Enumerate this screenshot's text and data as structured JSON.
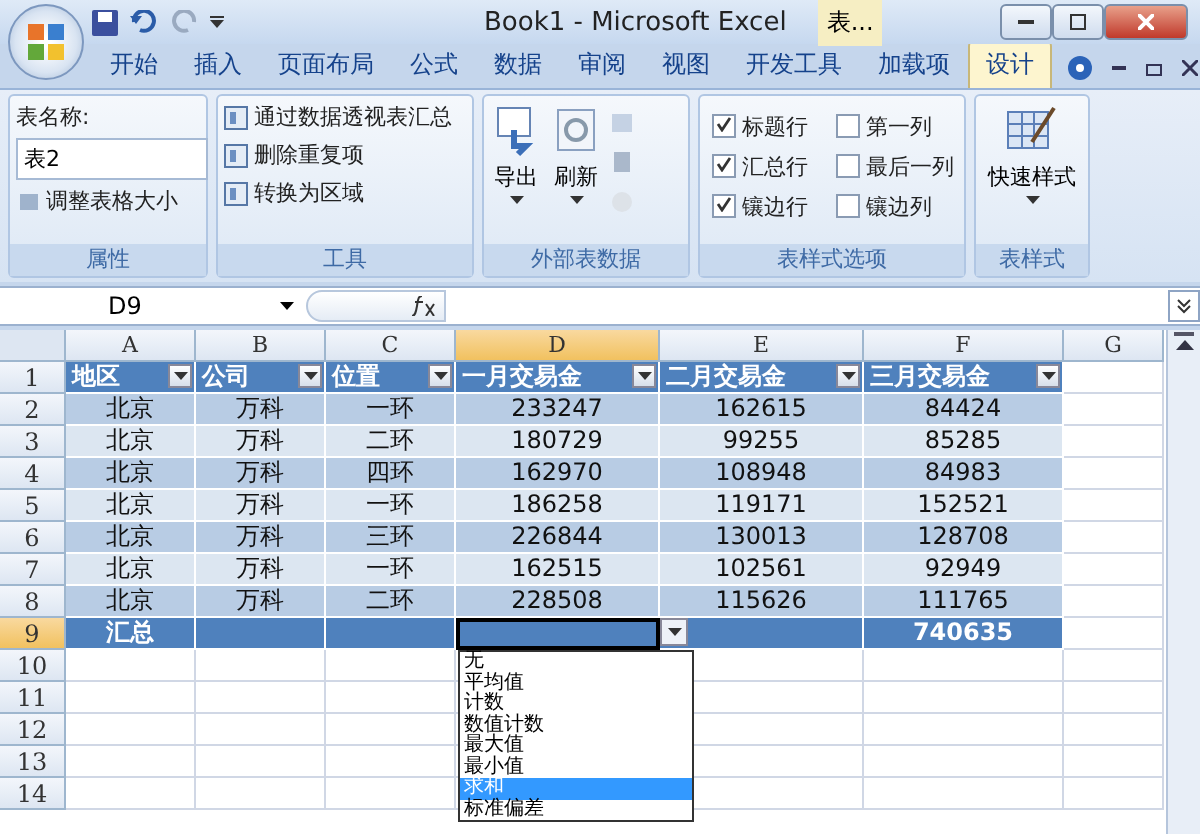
{
  "window": {
    "title": "Book1 - Microsoft Excel",
    "context_tab": "表..."
  },
  "ribbon_tabs": [
    {
      "label": "开始",
      "selected": false
    },
    {
      "label": "插入",
      "selected": false
    },
    {
      "label": "页面布局",
      "selected": false
    },
    {
      "label": "公式",
      "selected": false
    },
    {
      "label": "数据",
      "selected": false
    },
    {
      "label": "审阅",
      "selected": false
    },
    {
      "label": "视图",
      "selected": false
    },
    {
      "label": "开发工具",
      "selected": false
    },
    {
      "label": "加载项",
      "selected": false
    },
    {
      "label": "设计",
      "selected": true
    }
  ],
  "properties": {
    "label": "表名称:",
    "table_name": "表2",
    "resize": "调整表格大小",
    "caption": "属性"
  },
  "tools": {
    "items": [
      "通过数据透视表汇总",
      "删除重复项",
      "转换为区域"
    ],
    "caption": "工具"
  },
  "external_data": {
    "items": [
      "导出",
      "刷新"
    ],
    "caption": "外部表数据"
  },
  "style_options": {
    "options": [
      {
        "label": "标题行",
        "checked": true
      },
      {
        "label": "汇总行",
        "checked": true
      },
      {
        "label": "镶边行",
        "checked": true
      },
      {
        "label": "第一列",
        "checked": false
      },
      {
        "label": "最后一列",
        "checked": false
      },
      {
        "label": "镶边列",
        "checked": false
      }
    ],
    "caption": "表样式选项"
  },
  "table_styles": {
    "button": "快速样式",
    "caption": "表样式"
  },
  "formula_bar": {
    "name_box": "D9"
  },
  "columns": [
    {
      "label": "A",
      "selected": false
    },
    {
      "label": "B",
      "selected": false
    },
    {
      "label": "C",
      "selected": false
    },
    {
      "label": "D",
      "selected": true
    },
    {
      "label": "E",
      "selected": false
    },
    {
      "label": "F",
      "selected": false
    },
    {
      "label": "G",
      "selected": false
    }
  ],
  "table": {
    "headers": [
      "地区",
      "公司",
      "位置",
      "一月交易金",
      "二月交易金",
      "三月交易金"
    ],
    "rows": [
      [
        "北京",
        "万科",
        "一环",
        "233247",
        "162615",
        "84424"
      ],
      [
        "北京",
        "万科",
        "二环",
        "180729",
        "99255",
        "85285"
      ],
      [
        "北京",
        "万科",
        "四环",
        "162970",
        "108948",
        "84983"
      ],
      [
        "北京",
        "万科",
        "一环",
        "186258",
        "119171",
        "152521"
      ],
      [
        "北京",
        "万科",
        "三环",
        "226844",
        "130013",
        "128708"
      ],
      [
        "北京",
        "万科",
        "一环",
        "162515",
        "102561",
        "92949"
      ],
      [
        "北京",
        "万科",
        "二环",
        "228508",
        "115626",
        "111765"
      ]
    ],
    "total": {
      "label": "汇总",
      "value": "740635"
    }
  },
  "row_numbers": [
    {
      "label": "1",
      "selected": false
    },
    {
      "label": "2",
      "selected": false
    },
    {
      "label": "3",
      "selected": false
    },
    {
      "label": "4",
      "selected": false
    },
    {
      "label": "5",
      "selected": false
    },
    {
      "label": "6",
      "selected": false
    },
    {
      "label": "7",
      "selected": false
    },
    {
      "label": "8",
      "selected": false
    },
    {
      "label": "9",
      "selected": true
    },
    {
      "label": "10",
      "selected": false
    },
    {
      "label": "11",
      "selected": false
    },
    {
      "label": "12",
      "selected": false
    },
    {
      "label": "13",
      "selected": false
    },
    {
      "label": "14",
      "selected": false
    }
  ],
  "total_dropdown": {
    "items": [
      {
        "label": "无",
        "selected": false
      },
      {
        "label": "平均值",
        "selected": false
      },
      {
        "label": "计数",
        "selected": false
      },
      {
        "label": "数值计数",
        "selected": false
      },
      {
        "label": "最大值",
        "selected": false
      },
      {
        "label": "最小值",
        "selected": false
      },
      {
        "label": "求和",
        "selected": true
      },
      {
        "label": "标准偏差",
        "selected": false
      }
    ]
  }
}
